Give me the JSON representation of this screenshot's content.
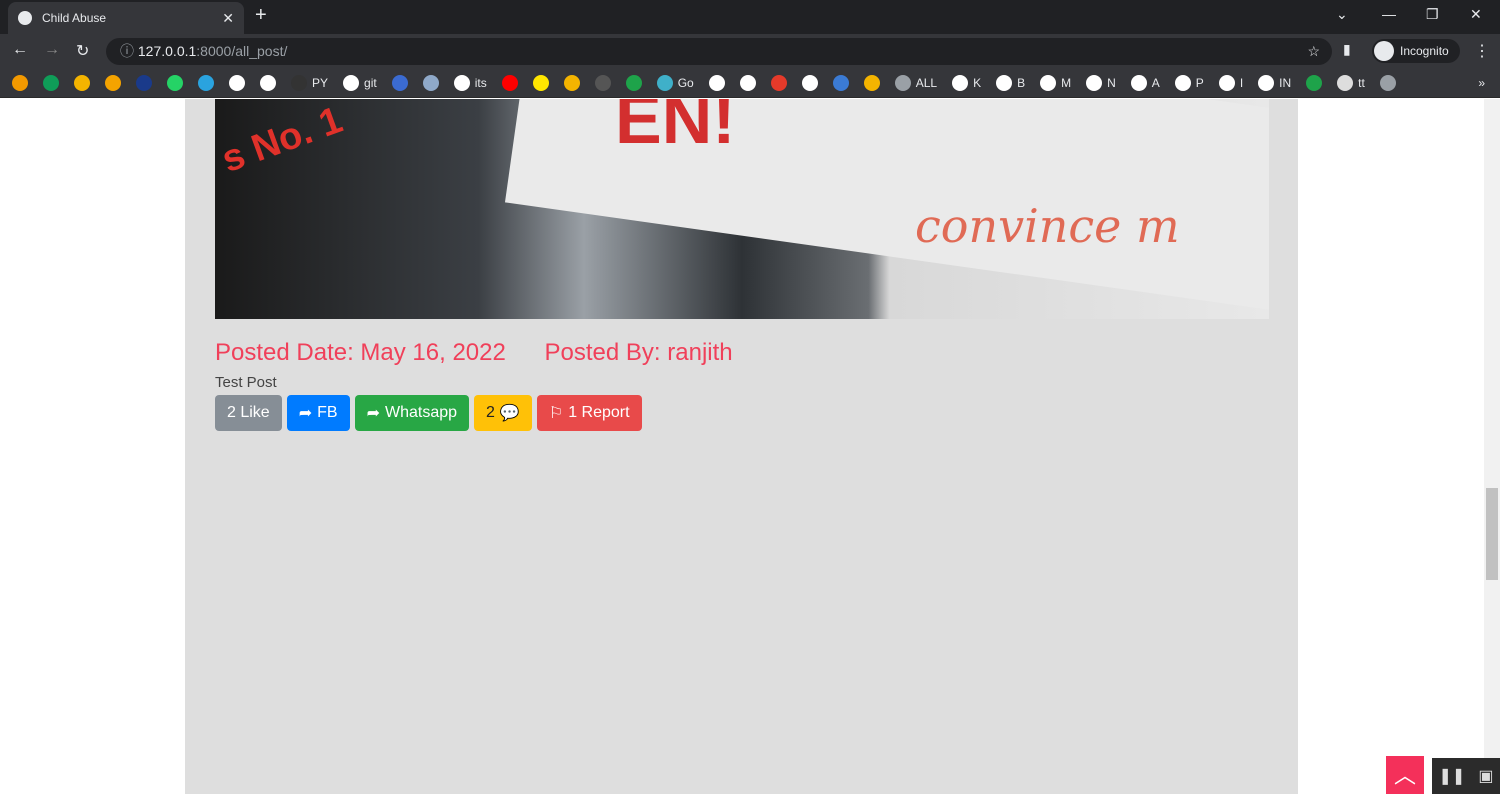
{
  "browser": {
    "tab_title": "Child Abuse",
    "url_host": "127.0.0.1",
    "url_rest": ":8000/all_post/",
    "profile": "Incognito",
    "bookmarks": [
      "",
      "",
      "",
      "",
      "",
      "",
      "",
      "",
      "",
      "PY",
      "git",
      "",
      "",
      "its",
      "",
      "",
      "",
      "",
      "",
      "Go",
      "",
      "",
      "",
      "",
      "",
      "",
      "ALL",
      "K",
      "B",
      "M",
      "N",
      "A",
      "P",
      "I",
      "IN",
      "",
      "tt",
      ""
    ],
    "bookmark_colors": [
      "#f29900",
      "#0f9d58",
      "#f4b400",
      "#f4a300",
      "#1a3a8a",
      "#25d366",
      "#2aa3df",
      "#fff",
      "#fff",
      "#333",
      "#fff",
      "#3b6bd1",
      "#8fa9c9",
      "#fff",
      "#ff0000",
      "#ffe600",
      "#f4b400",
      "#555",
      "#1ea34a",
      "#3fb0c9",
      "#fff",
      "#fff",
      "#e53a2a",
      "#fff",
      "#3b7bd4",
      "#f4b400",
      "#9aa0a6",
      "#fff",
      "#fff",
      "#fff",
      "#fff",
      "#fff",
      "#fff",
      "#fff",
      "#fff",
      "#1ea34a",
      "#ddd",
      "#9aa0a6"
    ],
    "overflow": "»"
  },
  "post": {
    "image_lettering": [
      "EN!",
      "s No. 1",
      "convince m"
    ],
    "posted_date": "Posted Date: May 16, 2022",
    "posted_by": "Posted By: ranjith",
    "description": "Test Post",
    "buttons": {
      "like": "2 Like",
      "fb": "FB",
      "whatsapp": "Whatsapp",
      "comments": "2",
      "report": "1 Report"
    },
    "colors": {
      "like": "#868e96",
      "fb": "#007bff",
      "whatsapp": "#28a745",
      "comments": "#ffc107",
      "report": "#e84a4a",
      "meta": "#f0405a"
    }
  }
}
